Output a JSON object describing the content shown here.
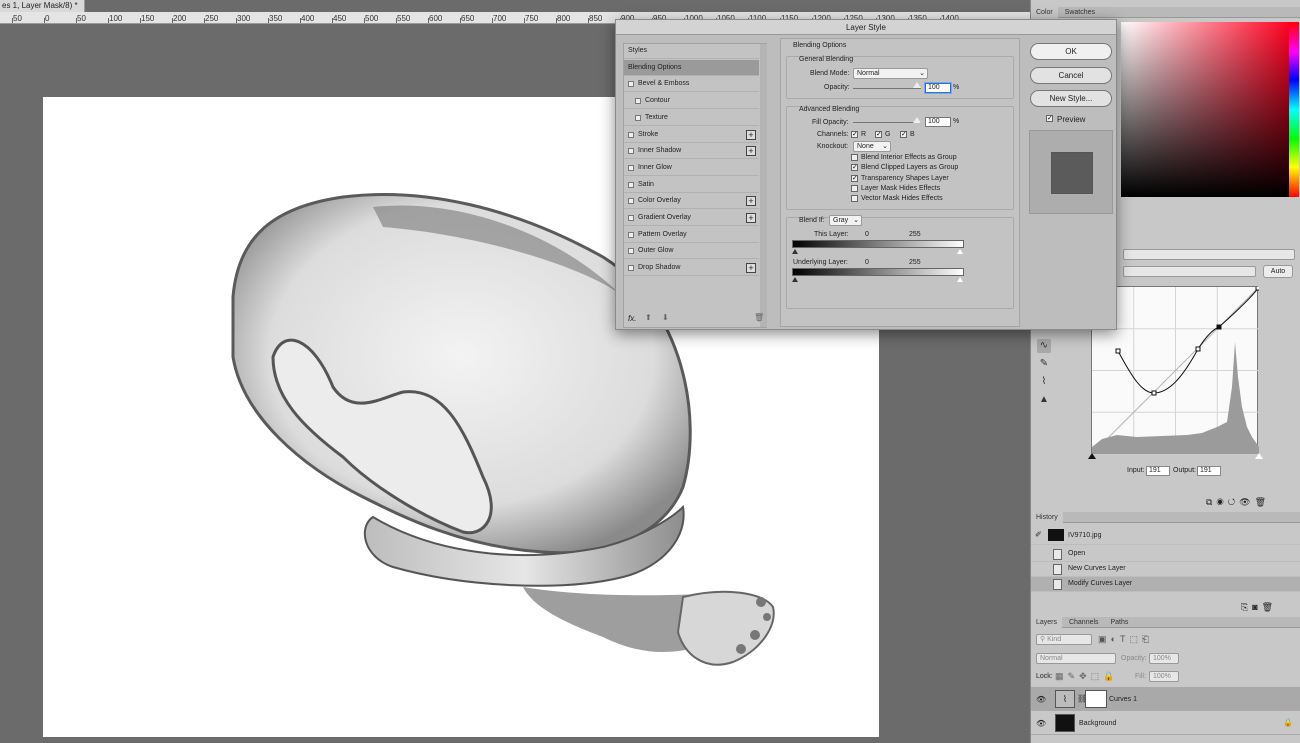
{
  "document": {
    "tab_title": "es 1, Layer Mask/8) *"
  },
  "ruler_top": {
    "ticks": [
      "50",
      "0",
      "50",
      "100",
      "150",
      "200",
      "250",
      "300",
      "350",
      "400",
      "450",
      "500",
      "550",
      "600",
      "650",
      "700",
      "750",
      "800",
      "850",
      "900",
      "950",
      "1000",
      "1050",
      "1100",
      "1150",
      "1200",
      "1250",
      "1300",
      "1350",
      "1400"
    ]
  },
  "color_panel": {
    "tabs": [
      "Color",
      "Swatches"
    ]
  },
  "properties": {
    "preset_value": "",
    "channel_value": "",
    "auto_label": "Auto",
    "input_label": "Input:",
    "input_value": "191",
    "output_label": "Output:",
    "output_value": "191"
  },
  "history": {
    "tab": "History",
    "snapshot_name": "IV9710.jpg",
    "items": [
      "Open",
      "New Curves Layer",
      "Modify Curves Layer"
    ]
  },
  "layers": {
    "tabs": [
      "Layers",
      "Channels",
      "Paths"
    ],
    "kind_label": "Kind",
    "blend_value": "Normal",
    "opacity_label": "Opacity:",
    "opacity_value": "100%",
    "lock_label": "Lock:",
    "fill_label": "Fill:",
    "fill_value": "100%",
    "items": [
      {
        "name": "Curves 1"
      },
      {
        "name": "Background"
      }
    ]
  },
  "dialog": {
    "title": "Layer Style",
    "styles": [
      {
        "label": "Styles",
        "checkbox": false,
        "plus": false,
        "indent": 0
      },
      {
        "label": "Blending Options",
        "checkbox": false,
        "plus": false,
        "indent": 0
      },
      {
        "label": "Bevel & Emboss",
        "checkbox": true,
        "plus": false,
        "indent": 0
      },
      {
        "label": "Contour",
        "checkbox": true,
        "plus": false,
        "indent": 1
      },
      {
        "label": "Texture",
        "checkbox": true,
        "plus": false,
        "indent": 1
      },
      {
        "label": "Stroke",
        "checkbox": true,
        "plus": true,
        "indent": 0
      },
      {
        "label": "Inner Shadow",
        "checkbox": true,
        "plus": true,
        "indent": 0
      },
      {
        "label": "Inner Glow",
        "checkbox": true,
        "plus": false,
        "indent": 0
      },
      {
        "label": "Satin",
        "checkbox": true,
        "plus": false,
        "indent": 0
      },
      {
        "label": "Color Overlay",
        "checkbox": true,
        "plus": true,
        "indent": 0
      },
      {
        "label": "Gradient Overlay",
        "checkbox": true,
        "plus": true,
        "indent": 0
      },
      {
        "label": "Pattern Overlay",
        "checkbox": true,
        "plus": false,
        "indent": 0
      },
      {
        "label": "Outer Glow",
        "checkbox": true,
        "plus": false,
        "indent": 0
      },
      {
        "label": "Drop Shadow",
        "checkbox": true,
        "plus": true,
        "indent": 0
      }
    ],
    "fx_label": "fx.",
    "blending": {
      "section_title": "Blending Options",
      "general_title": "General Blending",
      "blend_mode_label": "Blend Mode:",
      "blend_mode_value": "Normal",
      "opacity_label": "Opacity:",
      "opacity_value": "100",
      "opacity_fraction": 1.0,
      "percent": "%",
      "advanced_title": "Advanced Blending",
      "fill_opacity_label": "Fill Opacity:",
      "fill_opacity_value": "100",
      "fill_fraction": 1.0,
      "channels_label": "Channels:",
      "channel_r": "R",
      "channel_g": "G",
      "channel_b": "B",
      "knockout_label": "Knockout:",
      "knockout_value": "None",
      "options": [
        {
          "label": "Blend Interior Effects as Group",
          "checked": false
        },
        {
          "label": "Blend Clipped Layers as Group",
          "checked": true
        },
        {
          "label": "Transparency Shapes Layer",
          "checked": true
        },
        {
          "label": "Layer Mask Hides Effects",
          "checked": false
        },
        {
          "label": "Vector Mask Hides Effects",
          "checked": false
        }
      ],
      "blend_if_label": "Blend If:",
      "blend_if_value": "Gray",
      "this_layer_label": "This Layer:",
      "this_layer_min": "0",
      "this_layer_max": "255",
      "underlying_label": "Underlying Layer:",
      "underlying_min": "0",
      "underlying_max": "255"
    },
    "buttons": {
      "ok": "OK",
      "cancel": "Cancel",
      "new_style": "New Style..."
    },
    "preview_label": "Preview"
  }
}
